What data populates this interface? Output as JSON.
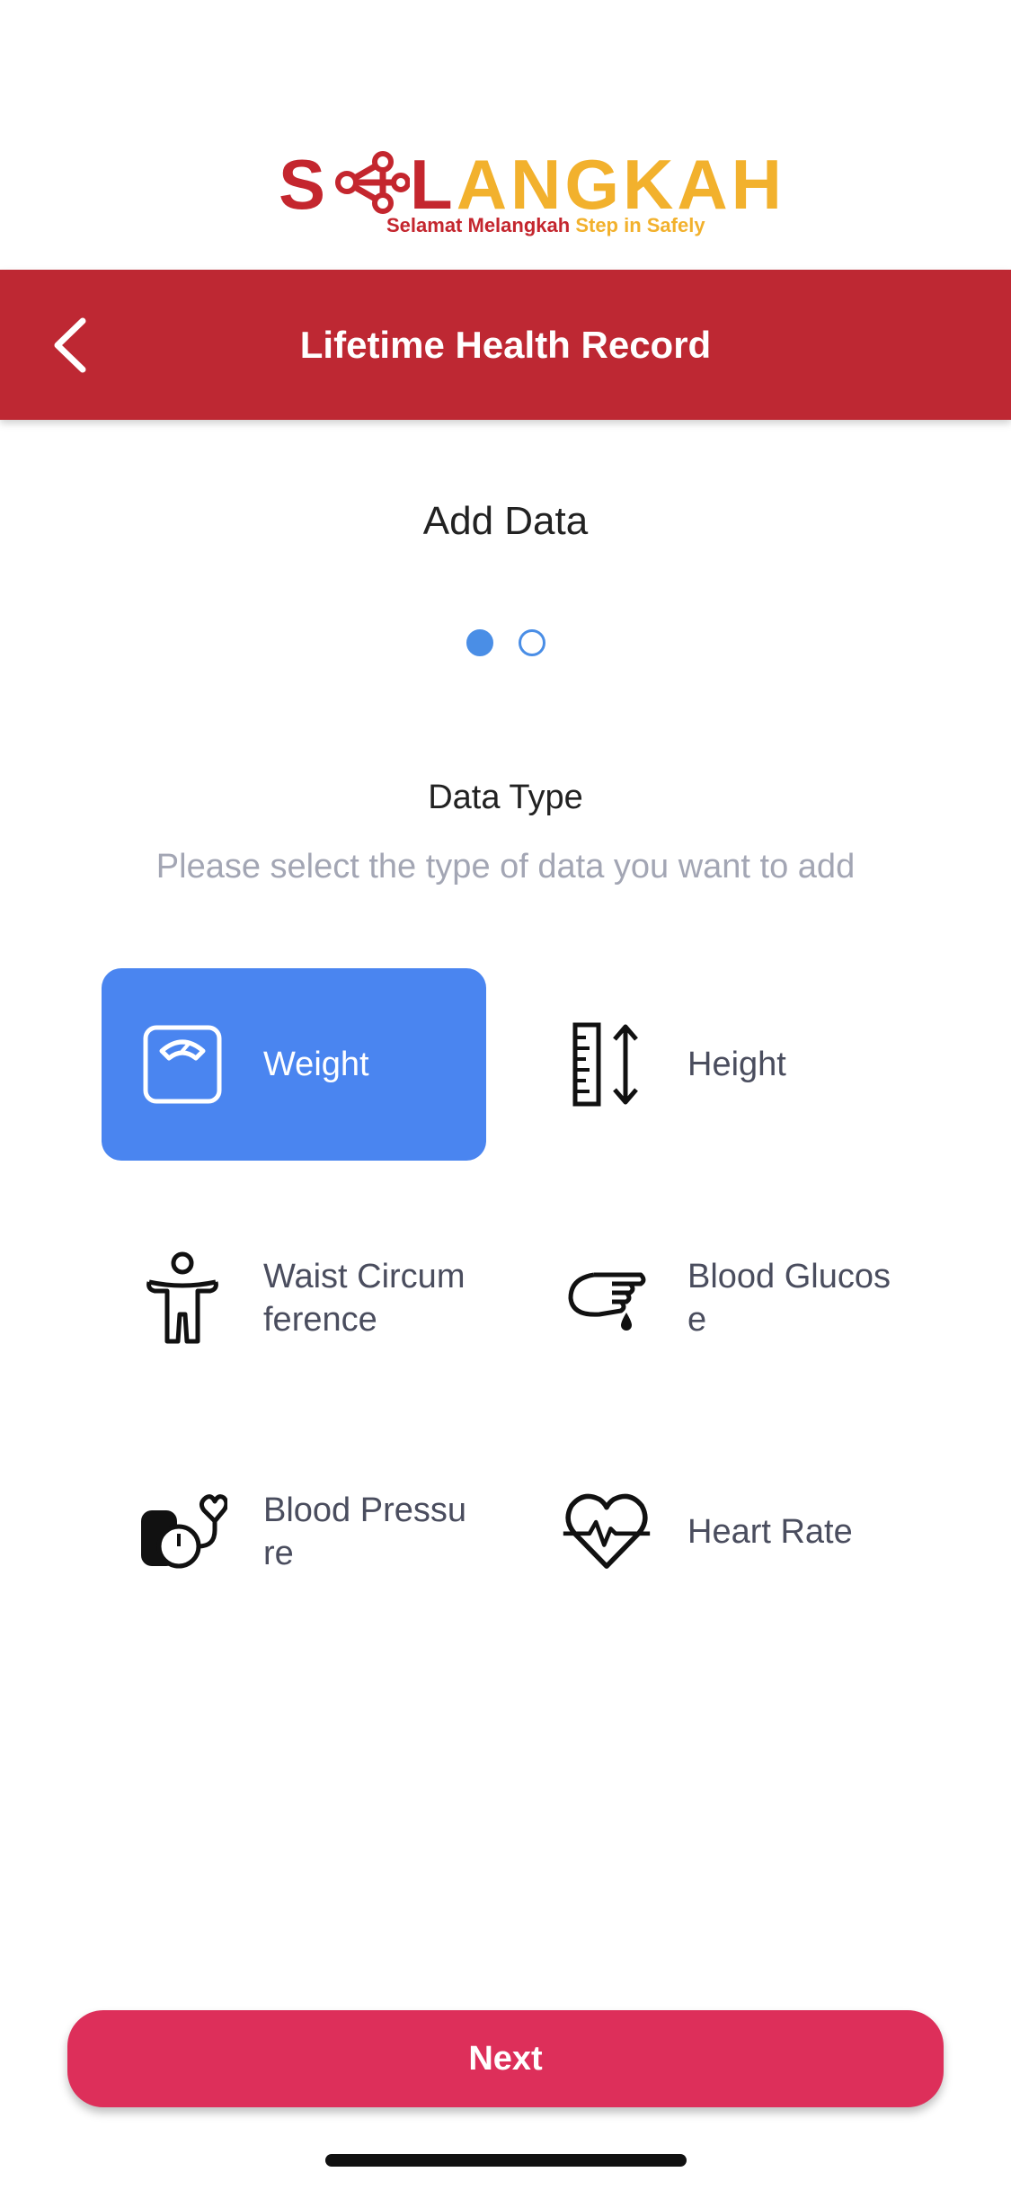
{
  "logo": {
    "letter_s": "S",
    "letter_l": "L",
    "word_rest": "ANGKAH",
    "tagline_primary": "Selamat Melangkah",
    "tagline_secondary": "Step in Safely",
    "colors": {
      "red": "#c4262e",
      "yellow": "#f2b12d"
    }
  },
  "header": {
    "title": "Lifetime Health Record",
    "back_icon": "chevron-left-icon",
    "background": "#be2833"
  },
  "step": {
    "title": "Add Data",
    "current_page": 1,
    "total_pages": 2
  },
  "section": {
    "title": "Data Type",
    "subtitle": "Please select the type of data you want to add"
  },
  "data_types": [
    {
      "label": "Weight",
      "icon": "weighing-scale-icon",
      "selected": true
    },
    {
      "label": "Height",
      "icon": "ruler-height-icon",
      "selected": false
    },
    {
      "label": "Waist Circumference",
      "icon": "body-outline-icon",
      "selected": false
    },
    {
      "label": "Blood Glucose",
      "icon": "finger-blood-drop-icon",
      "selected": false
    },
    {
      "label": "Blood Pressure",
      "icon": "blood-pressure-gauge-icon",
      "selected": false
    },
    {
      "label": "Heart Rate",
      "icon": "heart-pulse-icon",
      "selected": false
    }
  ],
  "footer": {
    "next_label": "Next",
    "accent": "#dd2f5a"
  },
  "colors": {
    "selected_tile": "#4a85f0",
    "dot_active": "#4a8ee6"
  }
}
